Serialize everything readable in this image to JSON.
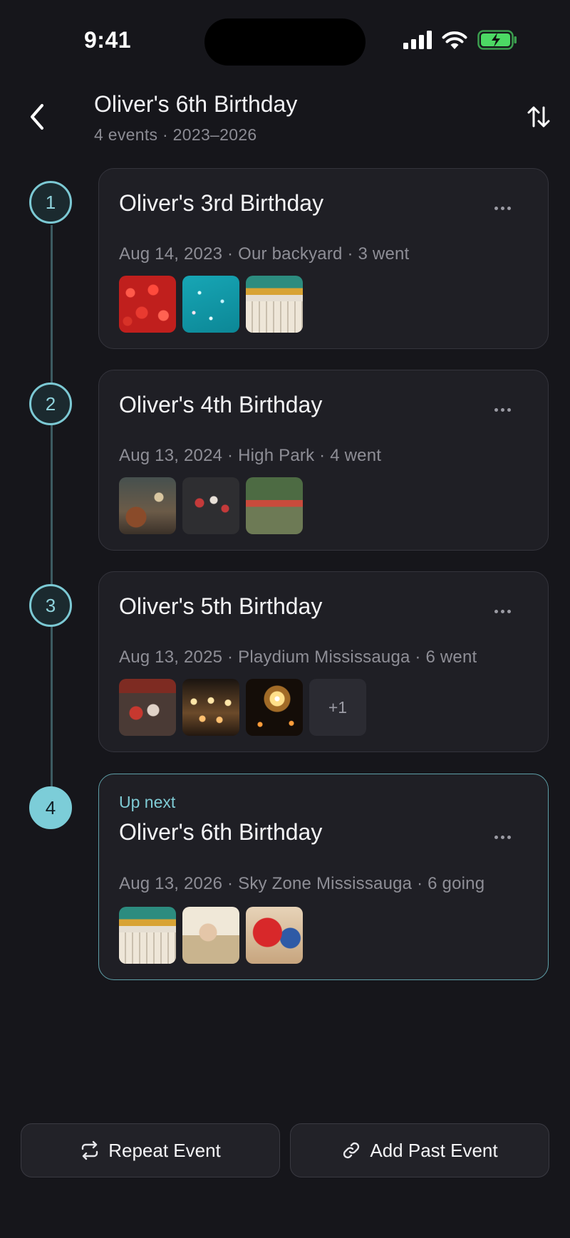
{
  "status_bar": {
    "time": "9:41"
  },
  "header": {
    "title": "Oliver's 6th Birthday",
    "subtitle": "4 events · 2023–2026"
  },
  "events": [
    {
      "step": "1",
      "title": "Oliver's 3rd Birthday",
      "meta": "Aug 14, 2023 · Our backyard · 3 went",
      "photos": [
        "strawberries-photo",
        "teal-confetti-photo",
        "balloons-photo"
      ]
    },
    {
      "step": "2",
      "title": "Oliver's 4th Birthday",
      "meta": "Aug 13, 2024 · High Park · 4 went",
      "photos": [
        "outdoor-party-photo",
        "chalkboard-photo",
        "banner-photo"
      ]
    },
    {
      "step": "3",
      "title": "Oliver's 5th Birthday",
      "meta": "Aug 13, 2025 · Playdium Mississauga · 6 went",
      "photos": [
        "crowd-photo",
        "string-lights-photo",
        "sparkler-photo"
      ],
      "more": "+1"
    },
    {
      "step": "4",
      "tag": "Up next",
      "title": "Oliver's 6th Birthday",
      "meta": "Aug 13, 2026 · Sky Zone Mississauga · 6 going",
      "photos": [
        "balloons-photo",
        "boy-photo",
        "superhero-photo"
      ]
    }
  ],
  "actions": {
    "repeat_label": "Repeat Event",
    "add_past_label": "Add Past Event"
  },
  "colors": {
    "background": "#16161b",
    "card": "#1f1f25",
    "accent": "#7ccdd8",
    "battery": "#4cd964"
  }
}
